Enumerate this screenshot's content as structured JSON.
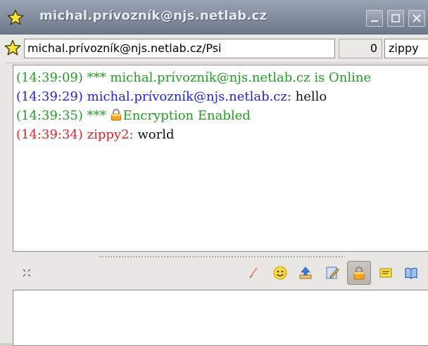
{
  "window": {
    "title": "michal.prívozník@njs.netlab.cz",
    "star_icon": "star-icon",
    "buttons": [
      "minimize-icon",
      "maximize-icon",
      "close-icon"
    ]
  },
  "toolbar": {
    "jid_value": "michal.prívozník@njs.netlab.cz/Psi",
    "message_count": "0",
    "nick_value": "zippy"
  },
  "chat": {
    "lines": [
      {
        "time": "(14:39:09)",
        "text": "*** michal.prívozník@njs.netlab.cz is Online"
      },
      {
        "time": "(14:39:29)",
        "sender": "michal.prívozník@njs.netlab.cz:",
        "message": "hello"
      },
      {
        "time": "(14:39:35)",
        "prefix": "***",
        "text": "Encryption Enabled",
        "icon": "lock-icon"
      },
      {
        "time": "(14:39:34)",
        "sender": "zippy2:",
        "message": "world"
      }
    ]
  },
  "actions": {
    "icons": [
      "expand-icon",
      "clear-icon",
      "smiley-icon",
      "send-file-icon",
      "edit-icon",
      "encrypt-lock-icon",
      "info-icon",
      "history-icon"
    ]
  },
  "colors": {
    "status": "#1f9e1f",
    "self": "#2222d6",
    "other": "#e0202a"
  }
}
